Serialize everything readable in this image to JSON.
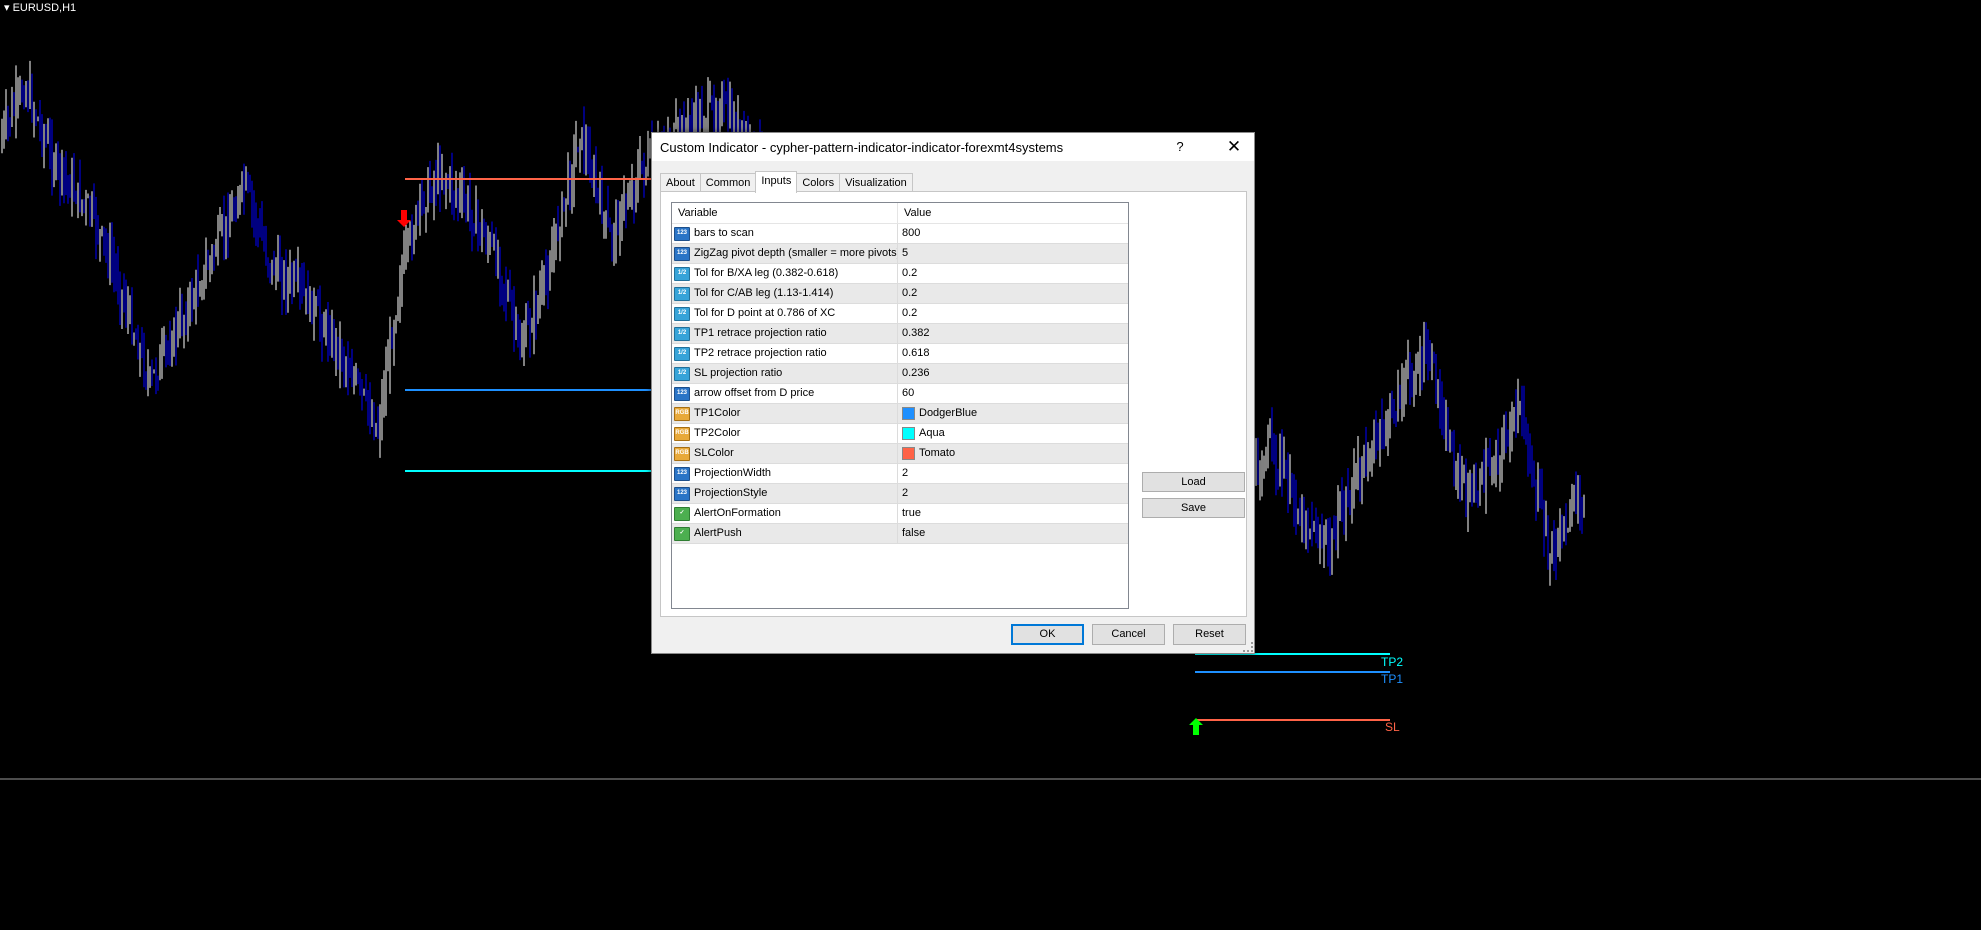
{
  "chart": {
    "symbol": "EURUSD,H1",
    "colors": {
      "background": "#000000",
      "bull": "#ffffff",
      "bear": "#0000ff",
      "sl": "#ff6347",
      "tp1": "#1e90ff",
      "tp2": "#00ffff",
      "arrow_down": "#ff0000",
      "arrow_up": "#00ff00"
    },
    "labels": {
      "tp2": "TP2",
      "tp1": "TP1",
      "sl": "SL"
    }
  },
  "dialog": {
    "title": "Custom Indicator - cypher-pattern-indicator-indicator-forexmt4systems",
    "help_label": "?",
    "close_label": "✕",
    "tabs": [
      {
        "label": "About"
      },
      {
        "label": "Common"
      },
      {
        "label": "Inputs"
      },
      {
        "label": "Colors"
      },
      {
        "label": "Visualization"
      }
    ],
    "active_tab": "Inputs",
    "table": {
      "headers": {
        "variable": "Variable",
        "value": "Value"
      },
      "rows": [
        {
          "icon": "int-icon",
          "type": "int",
          "variable": "bars to scan",
          "value": "800"
        },
        {
          "icon": "int-icon",
          "type": "int",
          "variable": "ZigZag pivot depth (smaller = more pivots)",
          "value": "5"
        },
        {
          "icon": "double-icon",
          "type": "dbl",
          "variable": "Tol for B/XA leg (0.382-0.618)",
          "value": "0.2"
        },
        {
          "icon": "double-icon",
          "type": "dbl",
          "variable": "Tol for C/AB leg (1.13-1.414)",
          "value": "0.2"
        },
        {
          "icon": "double-icon",
          "type": "dbl",
          "variable": "Tol for D point at 0.786 of XC",
          "value": "0.2"
        },
        {
          "icon": "double-icon",
          "type": "dbl",
          "variable": "TP1 retrace projection ratio",
          "value": "0.382"
        },
        {
          "icon": "double-icon",
          "type": "dbl",
          "variable": "TP2 retrace projection ratio",
          "value": "0.618"
        },
        {
          "icon": "double-icon",
          "type": "dbl",
          "variable": "SL projection ratio",
          "value": "0.236"
        },
        {
          "icon": "int-icon",
          "type": "int",
          "variable": "arrow offset from D price",
          "value": "60"
        },
        {
          "icon": "color-icon",
          "type": "clr",
          "variable": "TP1Color",
          "value": "DodgerBlue",
          "swatch": "#1e90ff"
        },
        {
          "icon": "color-icon",
          "type": "clr",
          "variable": "TP2Color",
          "value": "Aqua",
          "swatch": "#00ffff"
        },
        {
          "icon": "color-icon",
          "type": "clr",
          "variable": "SLColor",
          "value": "Tomato",
          "swatch": "#ff6347"
        },
        {
          "icon": "int-icon",
          "type": "int",
          "variable": "ProjectionWidth",
          "value": "2"
        },
        {
          "icon": "int-icon",
          "type": "int",
          "variable": "ProjectionStyle",
          "value": "2"
        },
        {
          "icon": "bool-icon",
          "type": "bool",
          "variable": "AlertOnFormation",
          "value": "true"
        },
        {
          "icon": "bool-icon",
          "type": "bool",
          "variable": "AlertPush",
          "value": "false"
        }
      ]
    },
    "buttons": {
      "load": "Load",
      "save": "Save",
      "ok": "OK",
      "cancel": "Cancel",
      "reset": "Reset"
    }
  }
}
